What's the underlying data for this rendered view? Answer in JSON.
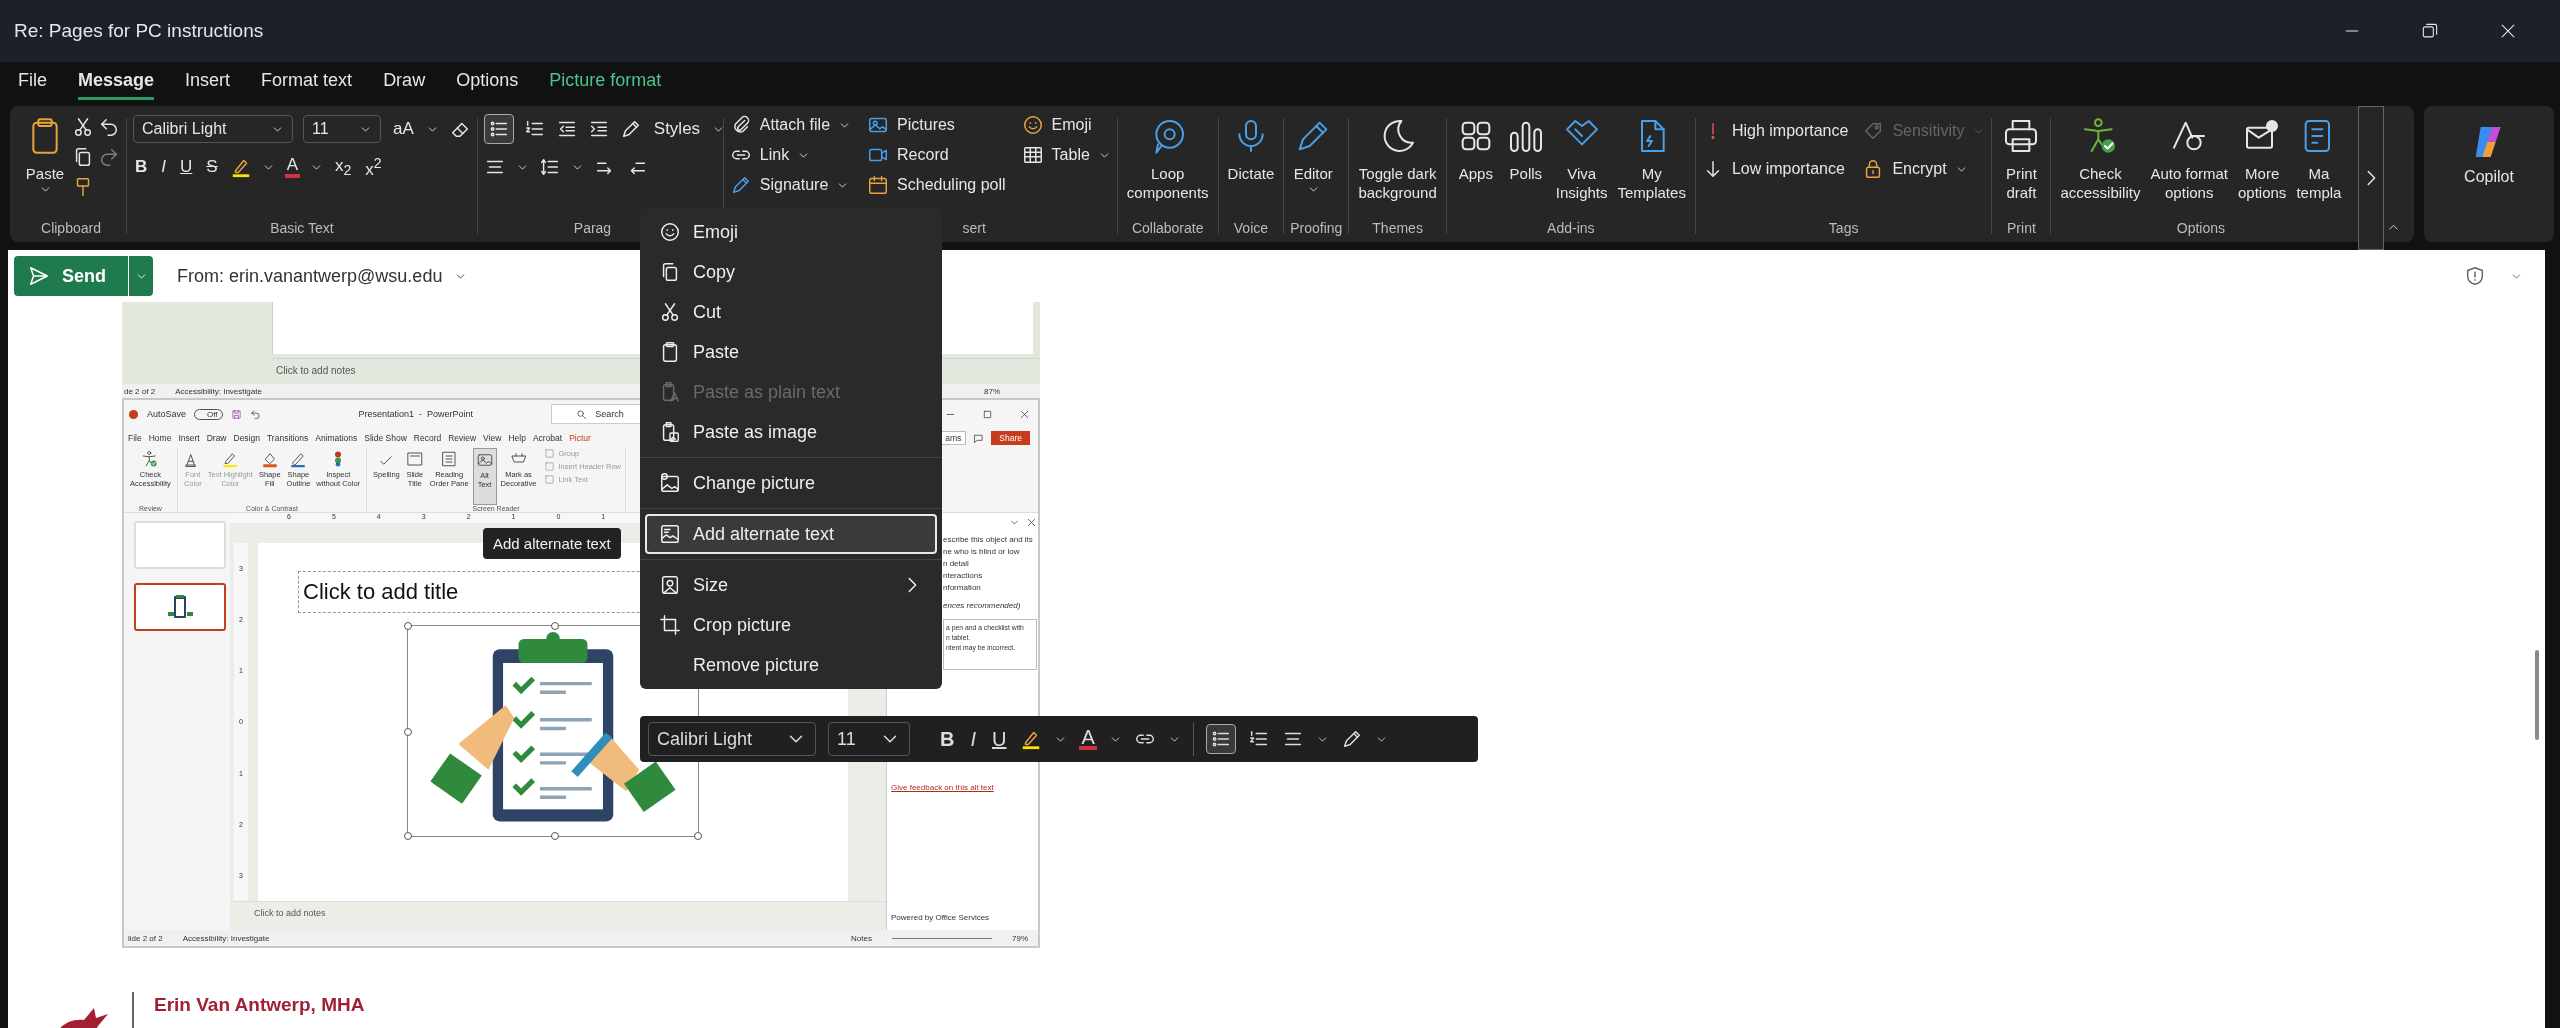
{
  "window": {
    "title": "Re: Pages for PC instructions"
  },
  "tabs": [
    {
      "label": "File",
      "selected": false,
      "kind": "normal"
    },
    {
      "label": "Message",
      "selected": true,
      "kind": "normal"
    },
    {
      "label": "Insert",
      "selected": false,
      "kind": "normal"
    },
    {
      "label": "Format text",
      "selected": false,
      "kind": "normal"
    },
    {
      "label": "Draw",
      "selected": false,
      "kind": "normal"
    },
    {
      "label": "Options",
      "selected": false,
      "kind": "normal"
    },
    {
      "label": "Picture format",
      "selected": false,
      "kind": "contextual"
    }
  ],
  "ribbon": {
    "clipboard": {
      "label": "Clipboard",
      "paste": "Paste"
    },
    "basic_text": {
      "label": "Basic Text",
      "font": "Calibri Light",
      "size": "11",
      "grow_shrink": "aA",
      "format_buttons": [
        "B",
        "I",
        "U",
        "S"
      ],
      "font_color": "A",
      "subscript": "x$_{2}$",
      "superscript": "x$^{2}$"
    },
    "paragraph": {
      "label": "Parag",
      "bullets_selected": true,
      "styles": "Styles"
    },
    "insert": {
      "label": "sert",
      "items": [
        {
          "label": "Attach file",
          "caret": true
        },
        {
          "label": "Link",
          "caret": true
        },
        {
          "label": "Signature",
          "caret": true
        },
        {
          "label": "Pictures",
          "caret": false
        },
        {
          "label": "Record",
          "caret": false
        },
        {
          "label": "Scheduling poll",
          "caret": false
        },
        {
          "label": "Emoji",
          "caret": false
        },
        {
          "label": "Table",
          "caret": true
        }
      ]
    },
    "large_groups": [
      {
        "label": "Collaborate",
        "buttons": [
          {
            "lines": [
              "Loop",
              "components"
            ],
            "caret": false
          }
        ]
      },
      {
        "label": "Voice",
        "buttons": [
          {
            "lines": [
              "Dictate"
            ],
            "caret": false
          }
        ]
      },
      {
        "label": "Proofing",
        "buttons": [
          {
            "lines": [
              "Editor"
            ],
            "caret": true
          }
        ]
      },
      {
        "label": "Themes",
        "buttons": [
          {
            "lines": [
              "Toggle dark",
              "background"
            ],
            "caret": false
          }
        ]
      },
      {
        "label": "Add-ins",
        "buttons": [
          {
            "lines": [
              "Apps"
            ],
            "caret": false
          },
          {
            "lines": [
              "Polls"
            ],
            "caret": false
          },
          {
            "lines": [
              "Viva",
              "Insights"
            ],
            "caret": false
          },
          {
            "lines": [
              "My",
              "Templates"
            ],
            "caret": false
          }
        ]
      }
    ],
    "tags": {
      "label": "Tags",
      "items": [
        {
          "label": "High importance",
          "disabled": false,
          "caret": false
        },
        {
          "label": "Low importance",
          "disabled": false,
          "caret": false
        },
        {
          "label": "Sensitivity",
          "disabled": true,
          "caret": true
        },
        {
          "label": "Encrypt",
          "disabled": false,
          "caret": true
        }
      ]
    },
    "print": {
      "label": "Print",
      "lines": [
        "Print",
        "draft"
      ]
    },
    "options": {
      "label": "Options",
      "buttons": [
        {
          "lines": [
            "Check",
            "accessibility"
          ]
        },
        {
          "lines": [
            "Auto format",
            "options"
          ]
        },
        {
          "lines": [
            "More",
            "options"
          ]
        },
        {
          "lines": [
            "Ma",
            "templa"
          ]
        }
      ]
    },
    "copilot": "Copilot"
  },
  "compose": {
    "send": "Send",
    "from": "From: erin.vanantwerp@wsu.edu"
  },
  "embedded_screenshot": {
    "upper": {
      "notes": "Click to add notes",
      "status": [
        "de 2 of 2",
        "Accessibility: Investigate"
      ],
      "zoom": "87%"
    },
    "app": {
      "autosave": "AutoSave",
      "autosave_state": "Off",
      "title": "Presentation1  -  PowerPoint",
      "search": "Search",
      "teams": "ams",
      "share": "Share",
      "tabs": [
        {
          "label": "File",
          "kind": "normal"
        },
        {
          "label": "Home",
          "kind": "normal"
        },
        {
          "label": "Insert",
          "kind": "normal"
        },
        {
          "label": "Draw",
          "kind": "normal"
        },
        {
          "label": "Design",
          "kind": "normal"
        },
        {
          "label": "Transitions",
          "kind": "normal"
        },
        {
          "label": "Animations",
          "kind": "normal"
        },
        {
          "label": "Slide Show",
          "kind": "normal"
        },
        {
          "label": "Record",
          "kind": "normal"
        },
        {
          "label": "Review",
          "kind": "normal"
        },
        {
          "label": "View",
          "kind": "normal"
        },
        {
          "label": "Help",
          "kind": "normal"
        },
        {
          "label": "Acrobat",
          "kind": "normal"
        },
        {
          "label": "Pictur",
          "kind": "contextual"
        }
      ],
      "ribbon_groups": [
        {
          "label": "Review",
          "items": [
            {
              "lines": [
                "Check",
                "Accessibility"
              ],
              "disabled": false,
              "selected": false
            }
          ]
        },
        {
          "label": "Color & Contrast",
          "items": [
            {
              "lines": [
                "Font",
                "Color"
              ],
              "disabled": true,
              "selected": false
            },
            {
              "lines": [
                "Text Highlight",
                "Color"
              ],
              "disabled": true,
              "selected": false
            },
            {
              "lines": [
                "Shape",
                "Fill"
              ],
              "disabled": false,
              "selected": false
            },
            {
              "lines": [
                "Shape",
                "Outline"
              ],
              "disabled": false,
              "selected": false
            },
            {
              "lines": [
                "Inspect",
                "without Color"
              ],
              "disabled": false,
              "selected": false
            }
          ]
        },
        {
          "label": "Screen Reader",
          "items": [
            {
              "lines": [
                "Spelling"
              ],
              "disabled": false,
              "selected": false
            },
            {
              "lines": [
                "Slide",
                "Title"
              ],
              "disabled": false,
              "selected": false
            },
            {
              "lines": [
                "Reading",
                "Order Pane"
              ],
              "disabled": false,
              "selected": false
            },
            {
              "lines": [
                "Alt",
                "Text"
              ],
              "disabled": false,
              "selected": true
            },
            {
              "lines": [
                "Mark as",
                "Decorative"
              ],
              "disabled": false,
              "selected": false
            }
          ],
          "small_items": [
            {
              "label": "Group",
              "disabled": true
            },
            {
              "label": "Insert Header Row",
              "disabled": true
            },
            {
              "label": "Link Text",
              "disabled": true
            }
          ]
        }
      ],
      "ruler": [
        "6",
        "5",
        "4",
        "3",
        "2",
        "1",
        "0",
        "1"
      ],
      "vertical_ruler": [
        "3",
        "2",
        "1",
        "0",
        "1",
        "2",
        "3"
      ],
      "thumbnails": [
        {
          "selected": false,
          "picture": false
        },
        {
          "selected": true,
          "picture": true
        }
      ],
      "slide_title": "Click to add title",
      "pane_lines": [
        "escribe this object and its",
        "ne who is blind or low",
        "n detail",
        "nteractions",
        "nformation"
      ],
      "pane_hint": "ences recommended)",
      "alt_box": [
        "a pen and a checklist with",
        "n tablet.",
        "ntent may be incorrect."
      ],
      "feedback_link": "Give feedback on this alt text",
      "powered_by": "Powered by Office Services",
      "notes": "Click to add notes",
      "status": [
        "lide 2 of 2",
        "Accessibility: Investigate"
      ],
      "notes_button": "Notes",
      "zoom": "79%"
    }
  },
  "signature": {
    "name": "Erin Van Antwerp, MHA"
  },
  "context_menu": {
    "sections": [
      [
        {
          "label": "Emoji",
          "disabled": false,
          "selected": false,
          "submenu": false
        },
        {
          "label": "Copy",
          "disabled": false,
          "selected": false,
          "submenu": false
        },
        {
          "label": "Cut",
          "disabled": false,
          "selected": false,
          "submenu": false
        },
        {
          "label": "Paste",
          "disabled": false,
          "selected": false,
          "submenu": false
        },
        {
          "label": "Paste as plain text",
          "disabled": true,
          "selected": false,
          "submenu": false
        },
        {
          "label": "Paste as image",
          "disabled": false,
          "selected": false,
          "submenu": false
        }
      ],
      [
        {
          "label": "Change picture",
          "disabled": false,
          "selected": false,
          "submenu": false
        }
      ],
      [
        {
          "label": "Add alternate text",
          "disabled": false,
          "selected": true,
          "submenu": false
        }
      ],
      [
        {
          "label": "Size",
          "disabled": false,
          "selected": false,
          "submenu": true
        },
        {
          "label": "Crop picture",
          "disabled": false,
          "selected": false,
          "submenu": false
        },
        {
          "label": "Remove picture",
          "disabled": false,
          "selected": false,
          "submenu": false
        }
      ]
    ]
  },
  "tooltip": "Add alternate text",
  "mini_toolbar": {
    "font": "Calibri Light",
    "size": "11",
    "format_buttons": [
      "B",
      "I",
      "U"
    ],
    "font_color": "A",
    "bullets_selected": true
  }
}
